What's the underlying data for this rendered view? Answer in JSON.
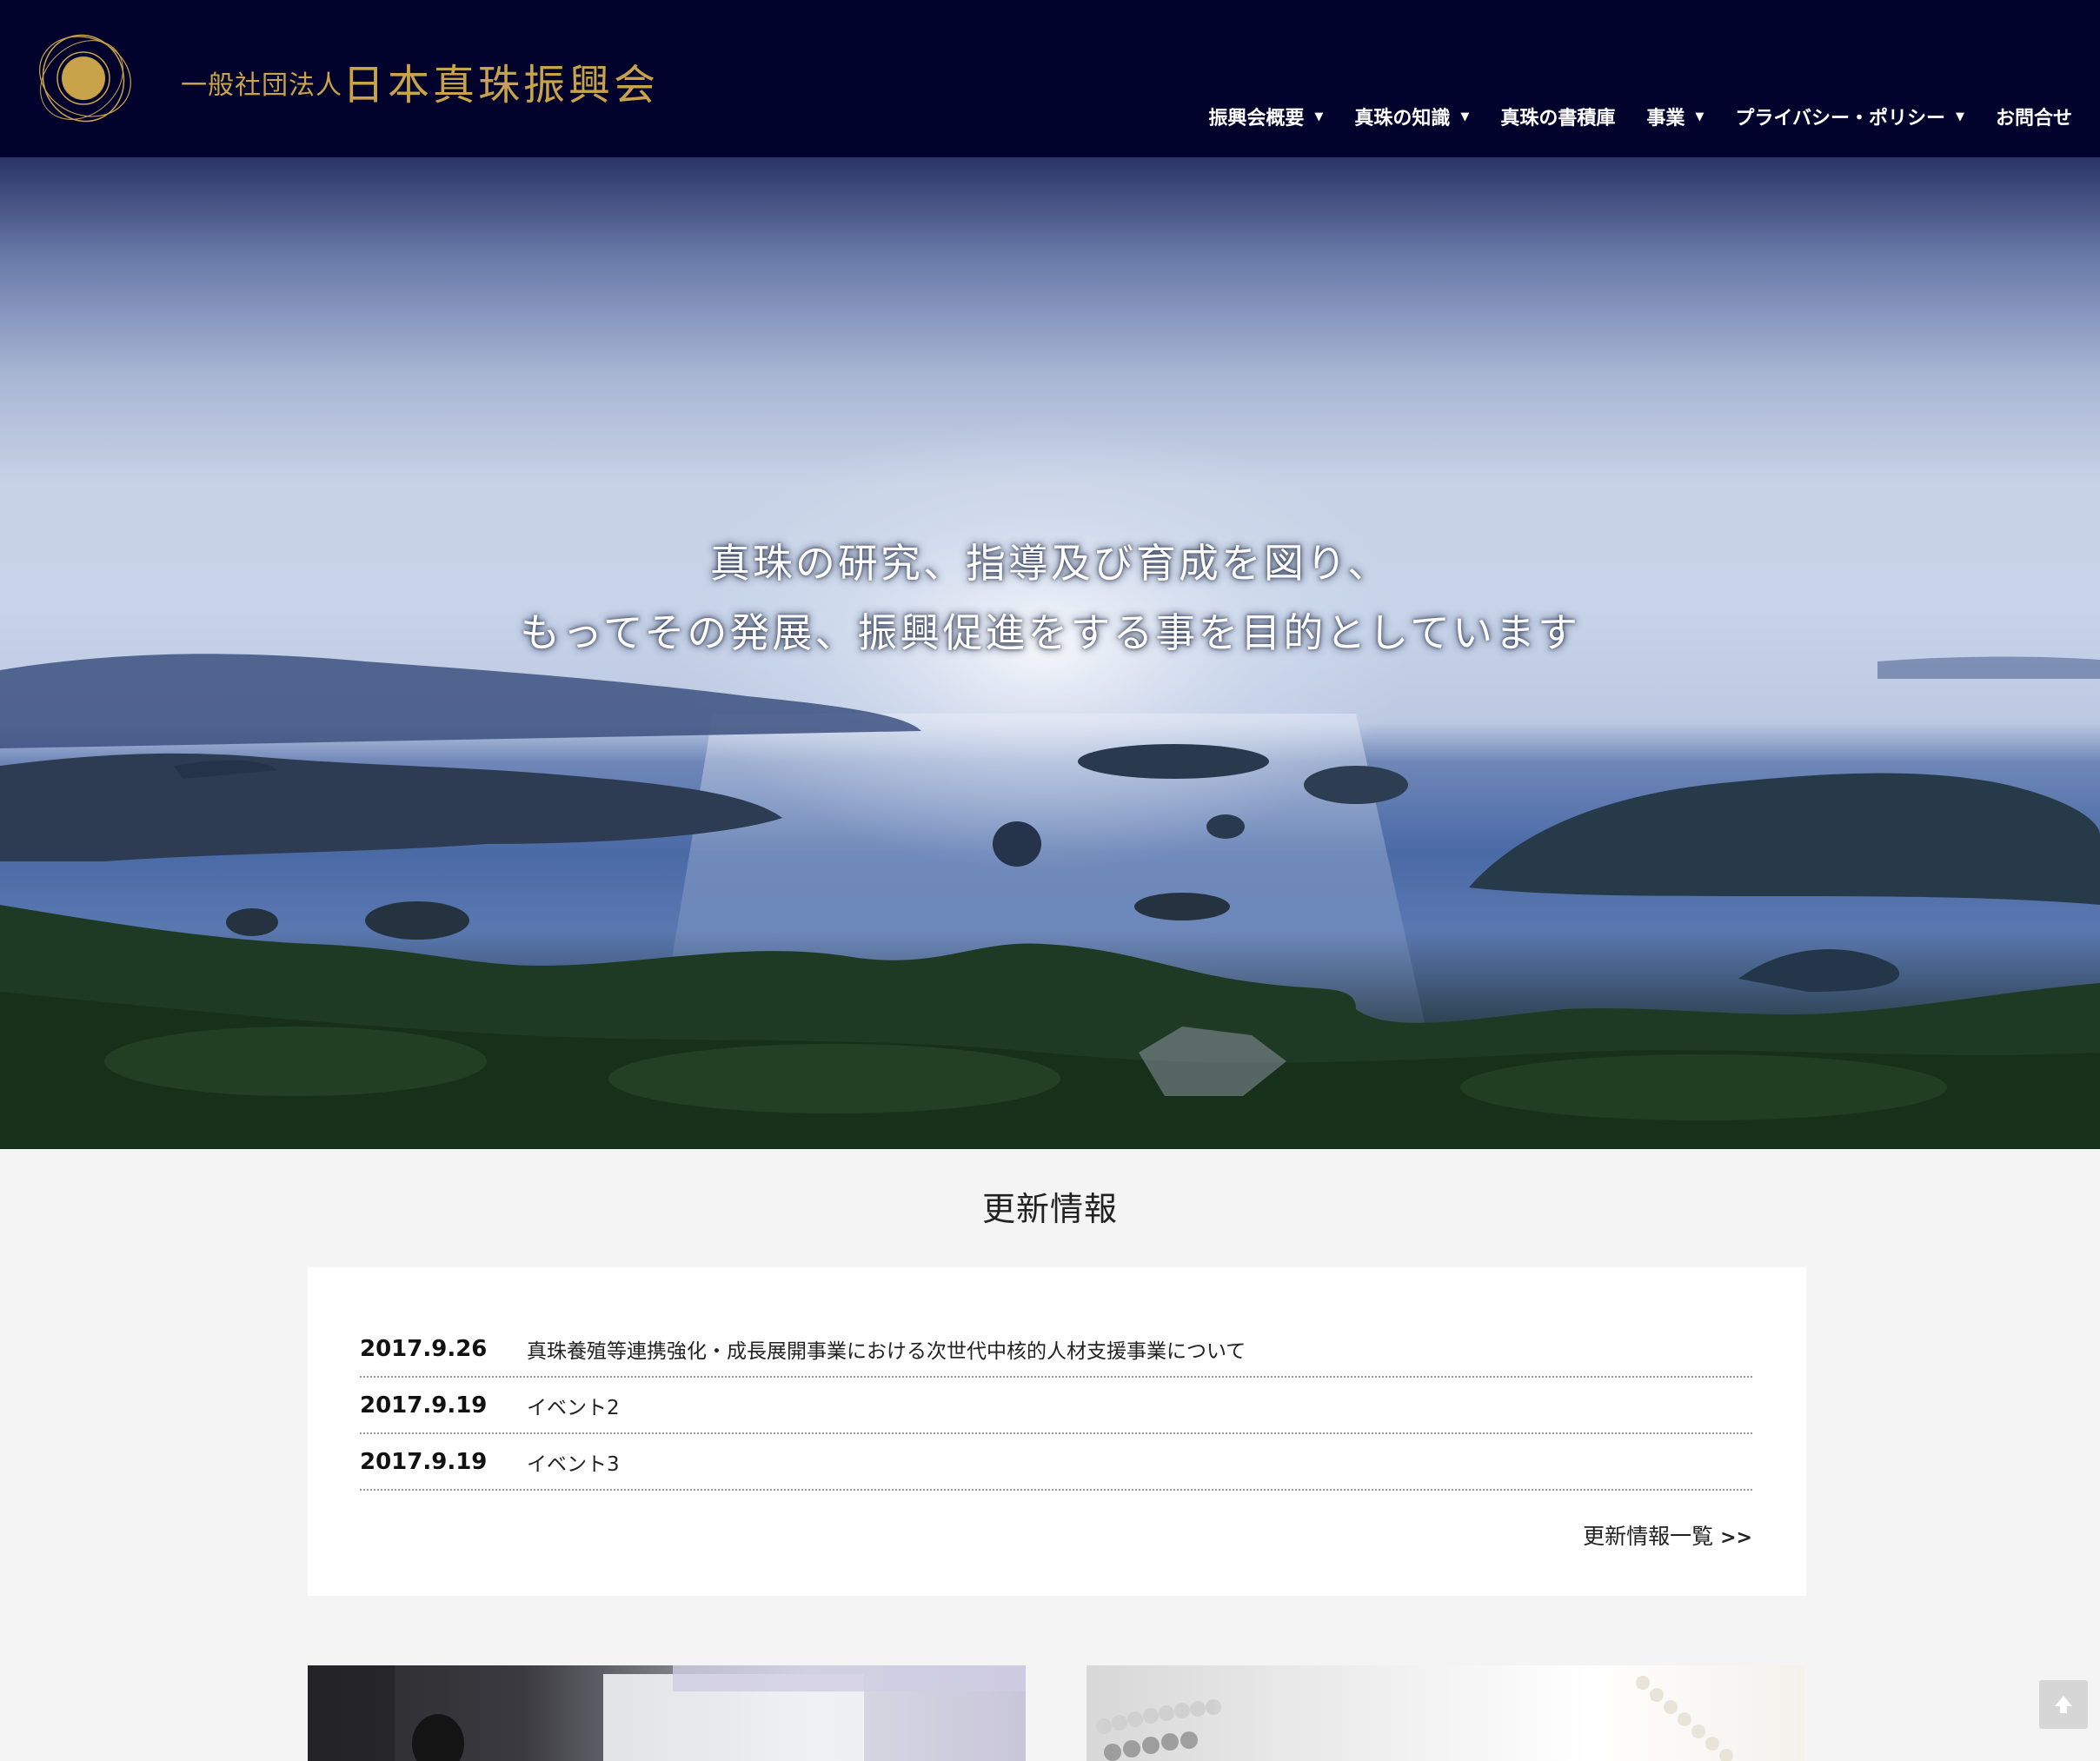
{
  "header": {
    "logo_small": "一般社団法人",
    "logo_big": "日本真珠振興会",
    "nav": [
      {
        "label": "振興会概要",
        "dropdown": true
      },
      {
        "label": "真珠の知識",
        "dropdown": true
      },
      {
        "label": "真珠の書積庫",
        "dropdown": false
      },
      {
        "label": "事業",
        "dropdown": true
      },
      {
        "label": "プライバシー・ポリシー",
        "dropdown": true
      },
      {
        "label": "お問合せ",
        "dropdown": false
      }
    ],
    "colors": {
      "background": "#02032c",
      "logo_gold": "#c9a34a"
    }
  },
  "hero": {
    "line1": "真珠の研究、指導及び育成を図り、",
    "line2": "もってその発展、振興促進をする事を目的としています"
  },
  "news": {
    "title": "更新情報",
    "items": [
      {
        "date": "2017.9.26",
        "text": "真珠養殖等連携強化・成長展開事業における次世代中核的人材支援事業について"
      },
      {
        "date": "2017.9.19",
        "text": "イベント2"
      },
      {
        "date": "2017.9.19",
        "text": "イベント3"
      }
    ],
    "more_label": "更新情報一覧",
    "more_arrow": ">>"
  },
  "icons": {
    "logo": "pearl-orbit-logo-icon",
    "caret": "caret-down-icon",
    "back_to_top": "arrow-up-icon"
  }
}
